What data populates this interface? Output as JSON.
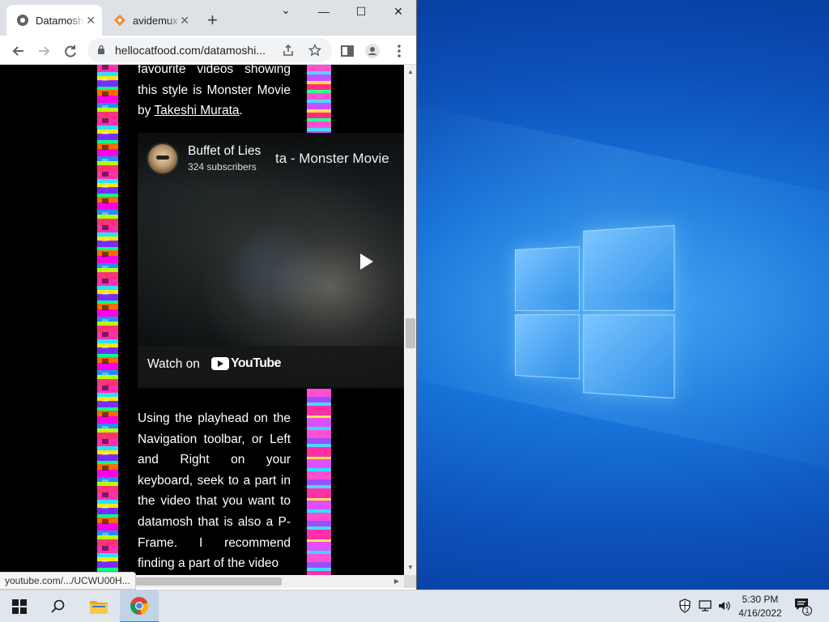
{
  "browser": {
    "tabs": [
      {
        "title": "Datamosh",
        "active": true
      },
      {
        "title": "avidemux",
        "active": false
      }
    ],
    "window_controls": {
      "minimize": "—",
      "maximize": "☐",
      "close": "✕",
      "tab_search": "⌄"
    },
    "new_tab_label": "+",
    "address_bar": {
      "url": "hellocatfood.com/datamoshi..."
    },
    "status_url": "youtube.com/.../UCWU00H..."
  },
  "page": {
    "paragraph1": {
      "text_before_link": "favourite videos showing this style is Monster Movie by ",
      "link_text": "Takeshi Murata",
      "text_after_link": "."
    },
    "video_embed": {
      "channel_name": "Buffet of Lies",
      "subscribers": "324 subscribers",
      "title_fragment": "ta - Monster Movie",
      "watch_on_label": "Watch on",
      "youtube_wordmark": "YouTube"
    },
    "paragraph2": "Using the playhead on the Navigation toolbar, or Left and Right on your keyboard, seek to a part in the video that you want to datamosh that is also a P-Frame. I recommend finding a part of the video"
  },
  "taskbar": {
    "pinned": [
      "start-button",
      "search-button",
      "file-explorer",
      "chrome"
    ],
    "clock_time": "5:30 PM",
    "clock_date": "4/16/2022",
    "notification_count": "1"
  },
  "colors": {
    "desktop_accent": "#1772d8",
    "chrome_tabstrip": "#dee1e6",
    "page_background": "#000000",
    "glitch_pink": "#ff2fb0"
  }
}
